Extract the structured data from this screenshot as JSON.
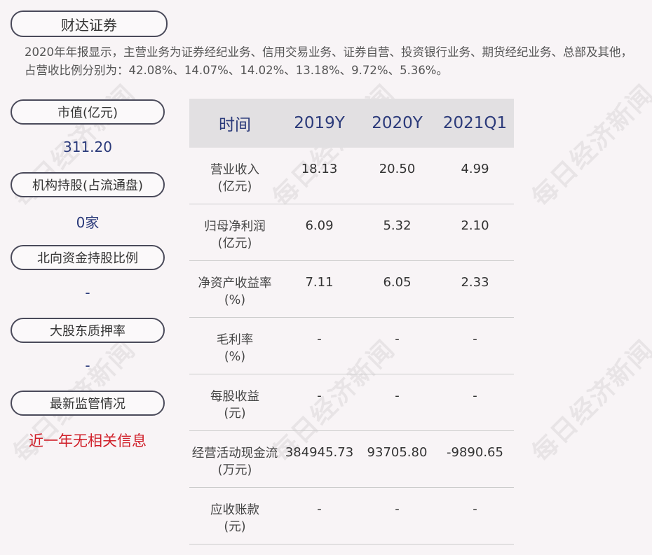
{
  "title": "财达证券",
  "summary": "2020年年报显示，主营业务为证券经纪业务、信用交易业务、证券自营、投资银行业务、期货经纪业务、总部及其他，占营收比例分别为：42.08%、14.07%、14.02%、13.18%、9.72%、5.36%。",
  "left_panel": [
    {
      "label": "市值(亿元)",
      "value": "311.20"
    },
    {
      "label": "机构持股(占流通盘)",
      "value": "0家"
    },
    {
      "label": "北向资金持股比例",
      "value": "-"
    },
    {
      "label": "大股东质押率",
      "value": "-"
    },
    {
      "label": "最新监管情况",
      "value": "近一年无相关信息"
    }
  ],
  "table": {
    "headers": [
      "时间",
      "2019Y",
      "2020Y",
      "2021Q1"
    ],
    "rows": [
      {
        "label": [
          "营业收入",
          "(亿元)"
        ],
        "values": [
          "18.13",
          "20.50",
          "4.99"
        ]
      },
      {
        "label": [
          "归母净利润",
          "(亿元)"
        ],
        "values": [
          "6.09",
          "5.32",
          "2.10"
        ]
      },
      {
        "label": [
          "净资产收益率",
          "(%)"
        ],
        "values": [
          "7.11",
          "6.05",
          "2.33"
        ]
      },
      {
        "label": [
          "毛利率",
          "(%)"
        ],
        "values": [
          "-",
          "-",
          "-"
        ]
      },
      {
        "label": [
          "每股收益",
          "(元)"
        ],
        "values": [
          "-",
          "-",
          "-"
        ]
      },
      {
        "label": [
          "经营活动现金流",
          "(万元)"
        ],
        "values": [
          "384945.73",
          "93705.80",
          "-9890.65"
        ]
      },
      {
        "label": [
          "应收账款",
          "(元)"
        ],
        "values": [
          "-",
          "-",
          "-"
        ]
      }
    ]
  },
  "watermark": "每日经济新闻",
  "colors": {
    "header_text": "#2b3a7a",
    "alert_text": "#d0202a",
    "header_bg": "#e2e0e2"
  }
}
